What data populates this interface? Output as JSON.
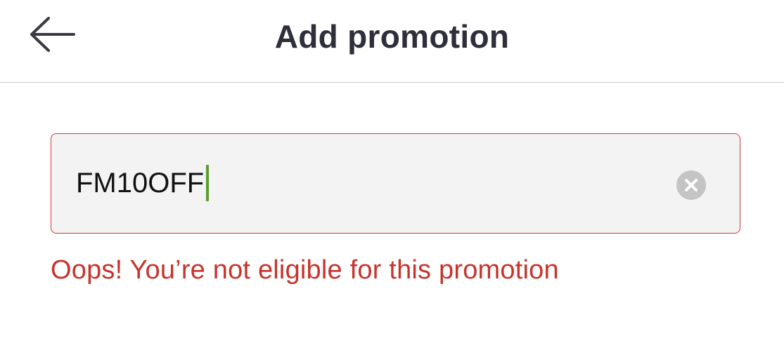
{
  "header": {
    "title": "Add promotion",
    "back_icon": "arrow-left-icon"
  },
  "promo": {
    "value": "FM10OFF",
    "clear_icon": "clear-circle-icon",
    "error_message": "Oops! You’re not eligible for this promotion"
  },
  "colors": {
    "error": "#c8332c",
    "field_border": "#cc3a36",
    "field_bg": "#f3f3f3",
    "caret": "#5a9d2e",
    "title": "#2f2e3b"
  }
}
